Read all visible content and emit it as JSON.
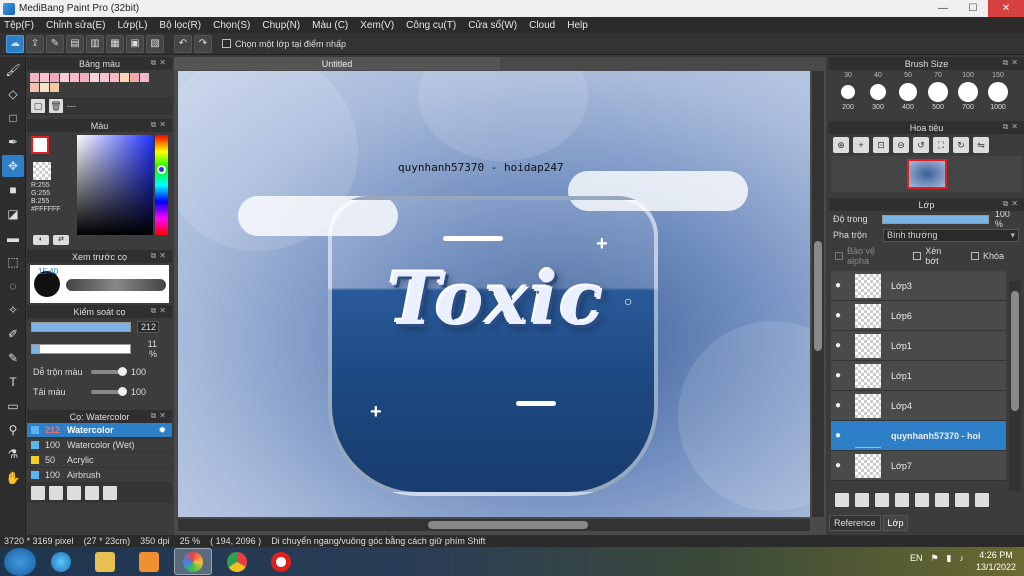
{
  "window": {
    "title": "MediBang Paint Pro (32bit)",
    "minimize": "—",
    "maximize": "☐",
    "close": "✕"
  },
  "menu": [
    "Tệp(F)",
    "Chỉnh sửa(E)",
    "Lớp(L)",
    "Bộ lọc(R)",
    "Chọn(S)",
    "Chụp(N)",
    "Màu (C)",
    "Xem(V)",
    "Công cụ(T)",
    "Cửa sổ(W)",
    "Cloud",
    "Help"
  ],
  "toolbar": {
    "checkbox_label": "Chọn một lớp tại điểm nhấp"
  },
  "panels": {
    "palette_title": "Bảng màu",
    "palette_label": "---",
    "color_title": "Màu",
    "color_r": "R:255",
    "color_g": "G:255",
    "color_b": "B:255",
    "color_hex": "#FFFFFF",
    "brush_preview_title": "Xem trước cọ",
    "brush_preview_size": "15.40",
    "control_title": "Kiểm soát cọ",
    "size_value": "212",
    "opacity_value": "11 %",
    "blend_label": "Dễ trộn màu",
    "blend_value": "100",
    "paint_label": "Tải màu",
    "paint_value": "100",
    "brush_title": "Cọ: Watercolor"
  },
  "brushes": [
    {
      "size": "212",
      "name": "Watercolor",
      "color": "#5ab4f0",
      "selected": true
    },
    {
      "size": "100",
      "name": "Watercolor (Wet)",
      "color": "#5ab4f0",
      "selected": false
    },
    {
      "size": "50",
      "name": "Acrylic",
      "color": "#f0d020",
      "selected": false
    },
    {
      "size": "100",
      "name": "Airbrush",
      "color": "#5ab4f0",
      "selected": false
    }
  ],
  "canvas": {
    "tab_title": "Untitled",
    "watermark": "quynhanh57370 - hoidap247",
    "art_text": "Toxic"
  },
  "right": {
    "brush_size_title": "Brush Size",
    "brush_sizes_top": [
      "30",
      "40",
      "50",
      "70",
      "100",
      "150"
    ],
    "brush_sizes": [
      "200",
      "300",
      "400",
      "500",
      "700",
      "1000"
    ],
    "navigator_title": "Hoa tiêu",
    "layer_title": "Lớp",
    "opacity_label": "Độ trong",
    "opacity_value": "100 %",
    "blend_label": "Pha trộn",
    "blend_value": "Bình thường",
    "protect_alpha": "Bảo vệ alpha",
    "clipping": "Xén bớt",
    "lock": "Khóa",
    "tab_reference": "Reference",
    "tab_layer": "Lớp"
  },
  "layers": [
    {
      "name": "Lớp3",
      "selected": false
    },
    {
      "name": "Lớp6",
      "selected": false
    },
    {
      "name": "Lớp1",
      "selected": false
    },
    {
      "name": "Lớp1",
      "selected": false
    },
    {
      "name": "Lớp4",
      "selected": false
    },
    {
      "name": "quynhanh57370 - hoi",
      "selected": true
    },
    {
      "name": "Lớp7",
      "selected": false
    }
  ],
  "status": {
    "dimensions": "3720 * 3169 pixel",
    "physical": "(27 * 23cm)",
    "dpi": "350 dpi",
    "zoom": "25 %",
    "cursor": "( 194, 2096 )",
    "hint": "Di chuyển ngang/vuông góc bằng cách giữ phím Shift"
  },
  "taskbar": {
    "time": "4:26 PM",
    "date": "13/1/2022",
    "lang": "EN"
  },
  "colors": {
    "accent": "#2d7fc8",
    "panel": "#3c3c3c"
  }
}
